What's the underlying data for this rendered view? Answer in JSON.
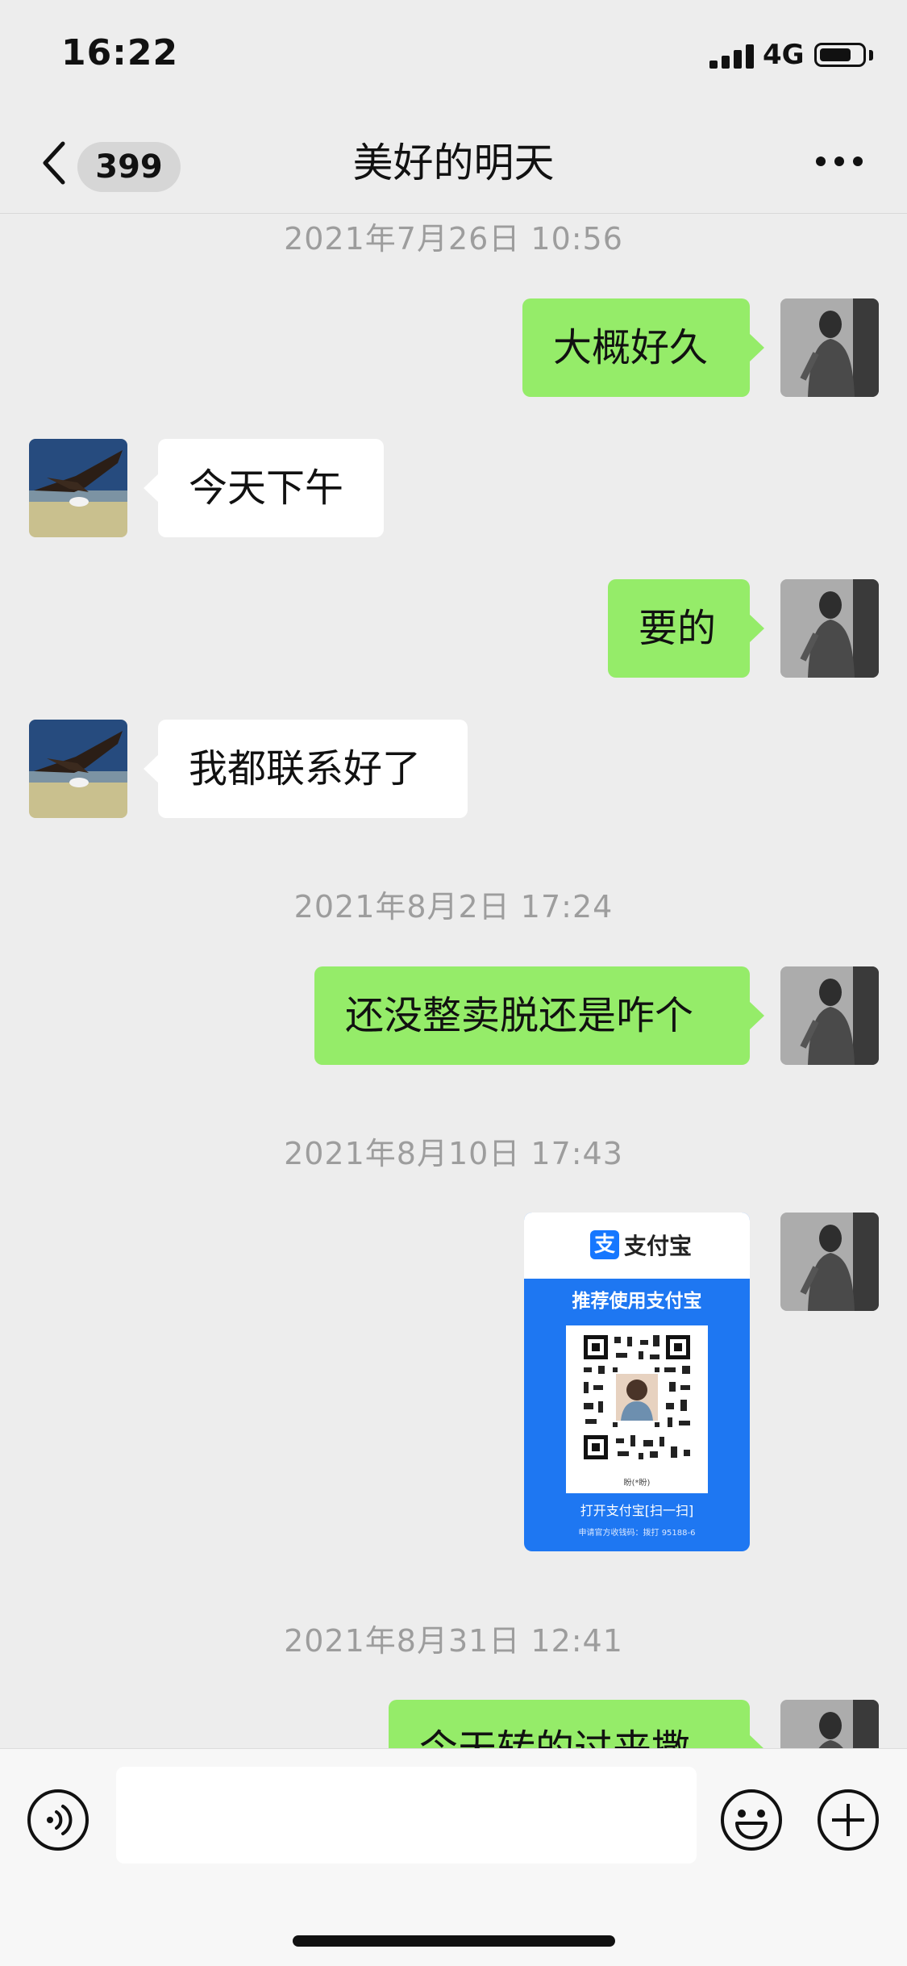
{
  "status_bar": {
    "time": "16:22",
    "network": "4G"
  },
  "nav": {
    "back_badge": "399",
    "title": "美好的明天",
    "icons": [
      "chevron-left-icon",
      "more-horizontal-icon"
    ]
  },
  "chat": {
    "timestamps": [
      "2021年7月26日 10:56",
      "2021年8月2日 17:24",
      "2021年8月10日 17:43",
      "2021年8月31日 12:41"
    ],
    "messages": [
      {
        "side": "me",
        "text": "大概好久"
      },
      {
        "side": "them",
        "text": "今天下午"
      },
      {
        "side": "me",
        "text": "要的"
      },
      {
        "side": "them",
        "text": "我都联系好了"
      },
      {
        "side": "me",
        "text": "还没整卖脱还是咋个"
      },
      {
        "side": "me",
        "text": "今天转的过来撒"
      }
    ],
    "payment_card": {
      "brand": "支付宝",
      "logo_char": "支",
      "recommend": "推荐使用支付宝",
      "payee": "盼(*盼)",
      "scan": "打开支付宝[扫一扫]",
      "apply": "申请官方收钱码：拨打 95188-6"
    }
  },
  "input_bar": {
    "icons": [
      "voice-icon",
      "emoji-icon",
      "plus-icon"
    ]
  },
  "colors": {
    "background": "#ededed",
    "bubble_me": "#95ec69",
    "bubble_them": "#ffffff",
    "timestamp": "#9d9d9d",
    "alipay_blue": "#1677ff"
  }
}
